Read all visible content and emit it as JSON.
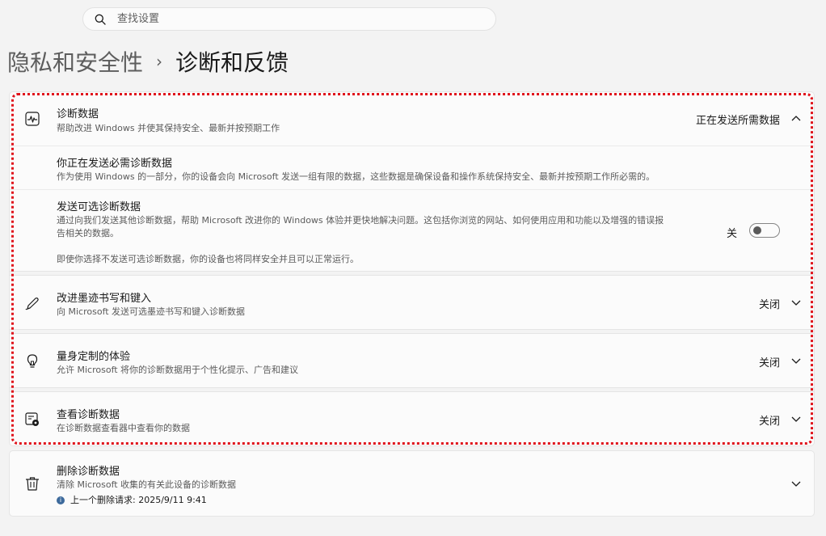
{
  "search": {
    "placeholder": "查找设置"
  },
  "breadcrumb": {
    "parent": "隐私和安全性",
    "separator": "›",
    "current": "诊断和反馈"
  },
  "diagnostic_data": {
    "title": "诊断数据",
    "subtitle": "帮助改进 Windows 并使其保持安全、最新并按预期工作",
    "status": "正在发送所需数据",
    "required": {
      "title": "你正在发送必需诊断数据",
      "description": "作为使用 Windows 的一部分，你的设备会向 Microsoft 发送一组有限的数据，这些数据是确保设备和操作系统保持安全、最新并按预期工作所必需的。"
    },
    "optional": {
      "title": "发送可选诊断数据",
      "description_line1": "通过向我们发送其他诊断数据，帮助 Microsoft 改进你的 Windows 体验并更快地解决问题。这包括你浏览的网站、如何使用应用和功能以及增强的错误报",
      "description_line2": "告相关的数据。",
      "toggle_label": "关",
      "toggle_on": false,
      "note": "即使你选择不发送可选诊断数据，你的设备也将同样安全并且可以正常运行。"
    }
  },
  "inking": {
    "title": "改进墨迹书写和键入",
    "subtitle": "向 Microsoft 发送可选墨迹书写和键入诊断数据",
    "status": "关闭"
  },
  "tailored": {
    "title": "量身定制的体验",
    "subtitle": "允许 Microsoft 将你的诊断数据用于个性化提示、广告和建议",
    "status": "关闭"
  },
  "view_data": {
    "title": "查看诊断数据",
    "subtitle": "在诊断数据查看器中查看你的数据",
    "status": "关闭"
  },
  "delete_data": {
    "title": "删除诊断数据",
    "subtitle": "清除 Microsoft 收集的有关此设备的诊断数据",
    "info_icon_glyph": "i",
    "last_request": "上一个删除请求: 2025/9/11 9:41"
  }
}
